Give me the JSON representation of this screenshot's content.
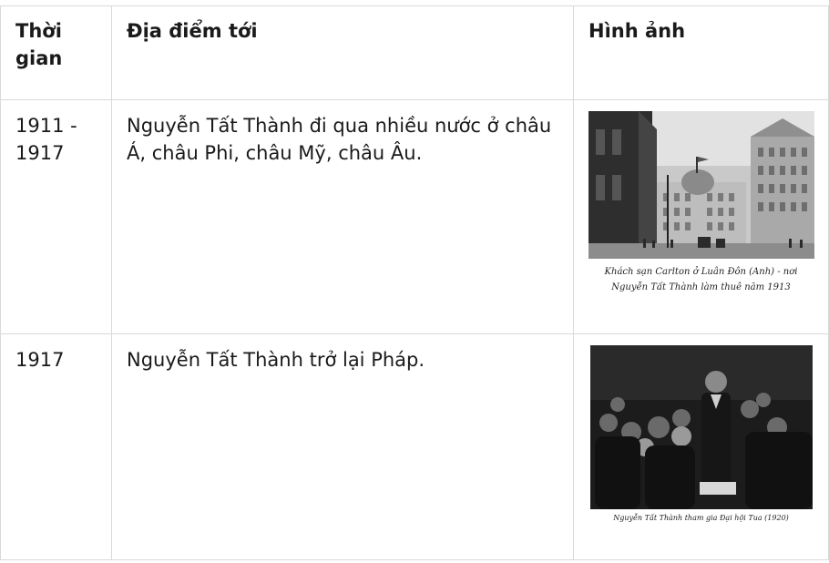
{
  "table": {
    "headers": [
      "Thời gian",
      "Địa điểm tới",
      "Hình ảnh"
    ],
    "rows": [
      {
        "time": "1911 - 1917",
        "place": "Nguyễn Tất Thành đi qua nhiều nước ở châu Á, châu Phi, châu Mỹ, châu Âu.",
        "image_caption_line1": "Khách sạn Carlton ở Luân Đôn (Anh) - nơi",
        "image_caption_line2": "Nguyễn Tất Thành làm thuê năm 1913"
      },
      {
        "time": "1917",
        "place": "Nguyễn Tất Thành trở lại Pháp.",
        "image_caption_line1": "Nguyễn Tất Thành tham gia Đại hội Tua (1920)"
      }
    ]
  },
  "images": {
    "row1": "photo-carlton-hotel-london",
    "row2": "photo-tours-congress-1920"
  }
}
